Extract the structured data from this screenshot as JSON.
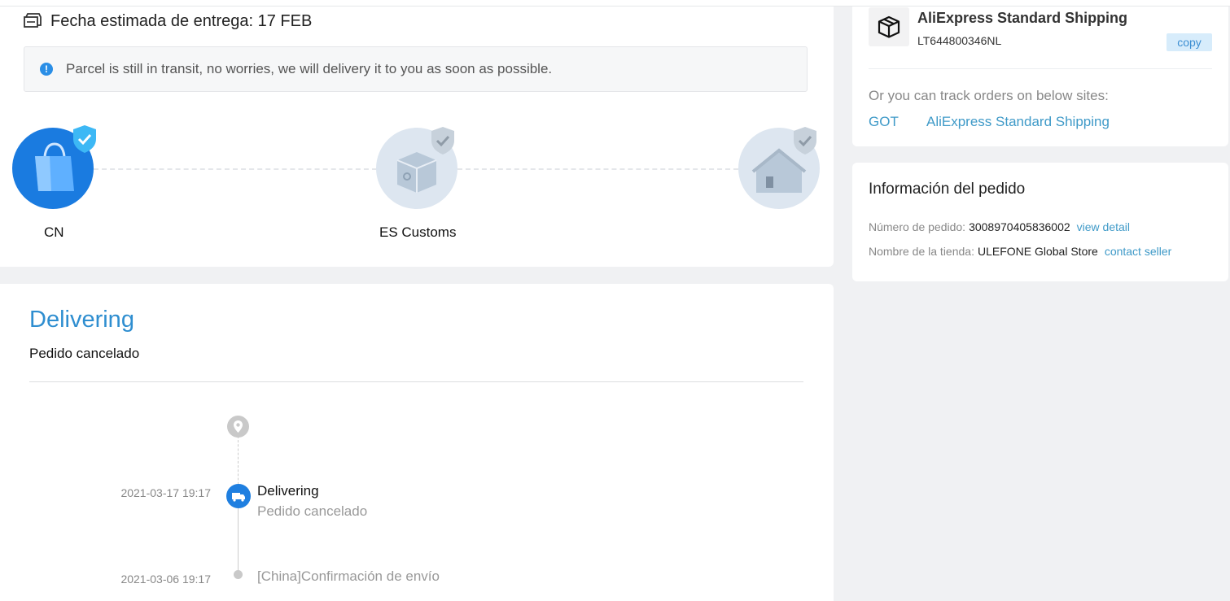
{
  "eta": {
    "text": "Fecha estimada de entrega: 17 FEB"
  },
  "notice": {
    "text": "Parcel is still in transit, no worries, we will delivery it to you as soon as possible."
  },
  "progress": {
    "nodes": [
      {
        "label": "CN",
        "state": "active"
      },
      {
        "label": "ES Customs",
        "state": "inactive"
      },
      {
        "label": "",
        "state": "inactive"
      }
    ]
  },
  "tracking": {
    "status_title": "Delivering",
    "status_subtitle": "Pedido cancelado",
    "events": [
      {
        "date": "2021-03-17 19:17",
        "title": "Delivering",
        "desc": "Pedido cancelado"
      },
      {
        "date": "2021-03-06 19:17",
        "title": "",
        "desc": "[China]Confirmación de envío"
      }
    ]
  },
  "carrier": {
    "name": "AliExpress Standard Shipping",
    "tracking_number": "LT644800346NL",
    "copy_label": "copy",
    "track_hint": "Or you can track orders on below sites:",
    "sites": [
      "GOT",
      "AliExpress Standard Shipping"
    ]
  },
  "order": {
    "title": "Información del pedido",
    "number_label": "Número de pedido:",
    "number": "3008970405836002",
    "view_detail": "view detail",
    "store_label": "Nombre de la tienda:",
    "store": "ULEFONE Global Store",
    "contact_seller": "contact seller"
  },
  "colors": {
    "accent": "#1a7be0",
    "link": "#3f9ac8",
    "title_blue": "#2f8ed0"
  }
}
